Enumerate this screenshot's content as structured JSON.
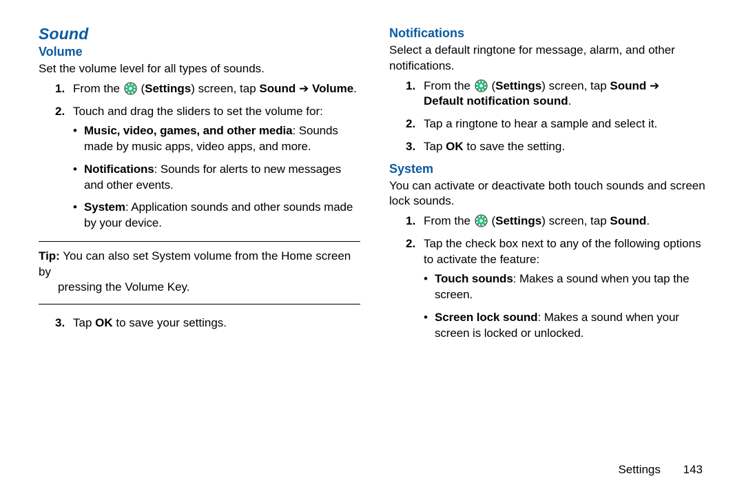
{
  "left": {
    "h1": "Sound",
    "volume": {
      "heading": "Volume",
      "intro": "Set the volume level for all types of sounds.",
      "step1_pre": "From the ",
      "step1_settings_label": "Settings",
      "step1_mid": ") screen, tap ",
      "step1_sound": "Sound",
      "step1_arrow": " ➔ ",
      "step1_volume": "Volume",
      "step1_end": ".",
      "step2": "Touch and drag the sliders to set the volume for:",
      "bullets": {
        "b1_bold": "Music, video, games, and other media",
        "b1_rest": ": Sounds made by music apps, video apps, and more.",
        "b2_bold": "Notifications",
        "b2_rest": ": Sounds for alerts to new messages and other events.",
        "b3_bold": "System",
        "b3_rest": ": Application sounds and other sounds made by your device."
      },
      "tip_label": "Tip:",
      "tip_text_line1": " You can also set System volume from the Home screen by",
      "tip_text_line2": "pressing the Volume Key.",
      "step3_pre": "Tap ",
      "step3_ok": "OK",
      "step3_post": " to save your settings."
    }
  },
  "right": {
    "notifications": {
      "heading": "Notifications",
      "intro": "Select a default ringtone for message, alarm, and other notifications.",
      "step1_pre": "From the ",
      "step1_settings_label": "Settings",
      "step1_mid": ") screen, tap ",
      "step1_sound": "Sound",
      "step1_arrow": " ➔ ",
      "step1_bold2": "Default notification sound",
      "step1_end": ".",
      "step2": "Tap a ringtone to hear a sample and select it.",
      "step3_pre": "Tap ",
      "step3_ok": "OK",
      "step3_post": " to save the setting."
    },
    "system": {
      "heading": "System",
      "intro": "You can activate or deactivate both touch sounds and screen lock sounds.",
      "step1_pre": "From the ",
      "step1_settings_label": "Settings",
      "step1_mid": ") screen, tap ",
      "step1_sound": "Sound",
      "step1_end": ".",
      "step2": "Tap the check box next to any of the following options to activate the feature:",
      "bullets": {
        "b1_bold": "Touch sounds",
        "b1_rest": ": Makes a sound when you tap the screen.",
        "b2_bold": "Screen lock sound",
        "b2_rest": ": Makes a sound when your screen is locked or unlocked."
      }
    }
  },
  "footer": {
    "section": "Settings",
    "page": "143"
  }
}
